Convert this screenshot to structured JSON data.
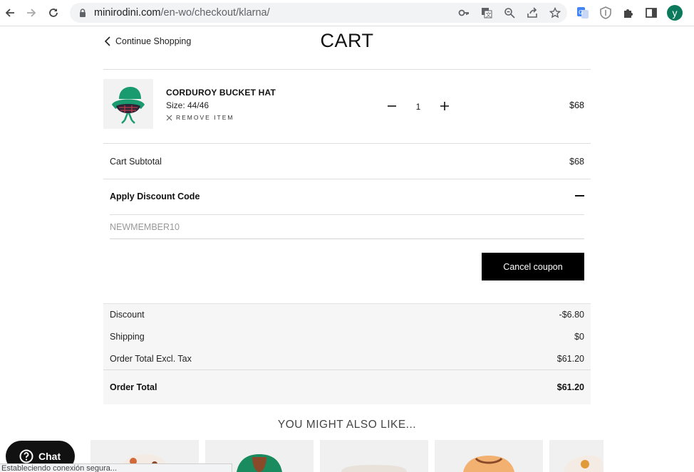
{
  "browser": {
    "url_domain": "minirodini.com",
    "url_path": "/en-wo/checkout/klarna/",
    "profile_initial": "y",
    "status_text": "Estableciendo conexión segura..."
  },
  "header": {
    "continue_label": "Continue Shopping",
    "title": "CART"
  },
  "cart_item": {
    "name": "CORDUROY BUCKET HAT",
    "size": "Size: 44/46",
    "remove_label": "REMOVE ITEM",
    "quantity": "1",
    "price": "$68"
  },
  "subtotal": {
    "label": "Cart Subtotal",
    "value": "$68"
  },
  "discount_section": {
    "label": "Apply Discount Code",
    "placeholder": "NEWMEMBER10",
    "cancel_label": "Cancel coupon"
  },
  "totals": {
    "discount_label": "Discount",
    "discount_value": "-$6.80",
    "shipping_label": "Shipping",
    "shipping_value": "$0",
    "excl_tax_label": "Order Total Excl. Tax",
    "excl_tax_value": "$61.20",
    "total_label": "Order Total",
    "total_value": "$61.20"
  },
  "recommendations": {
    "title": "YOU MIGHT ALSO LIKE..."
  },
  "chat": {
    "label": "Chat"
  },
  "colors": {
    "button_bg": "#000000",
    "profile_bg": "#0b7a5c",
    "hat_green": "#1a9b6f"
  }
}
